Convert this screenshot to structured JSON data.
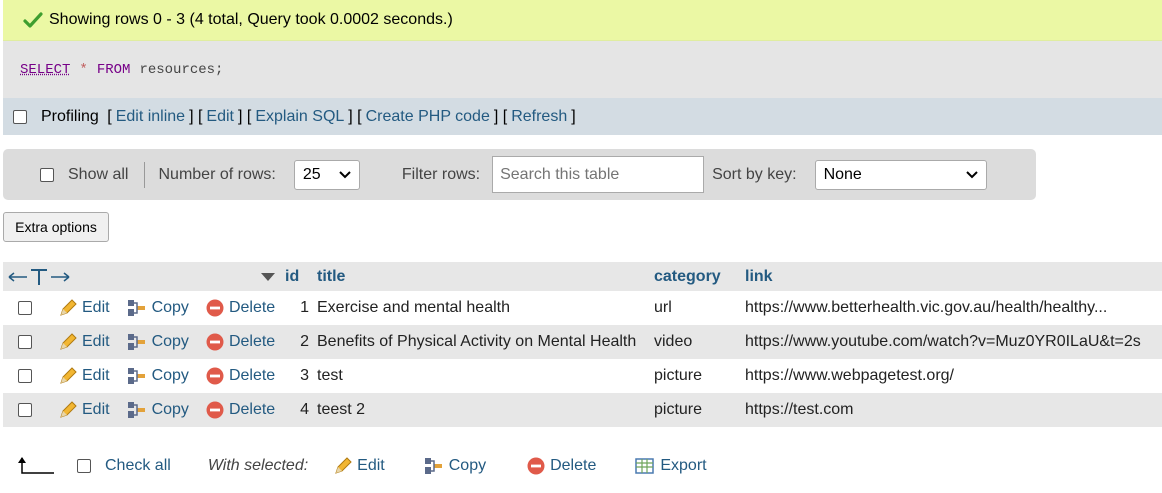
{
  "banner": {
    "message": "Showing rows 0 - 3 (4 total, Query took 0.0002 seconds.)"
  },
  "sql": {
    "select": "SELECT",
    "star": "*",
    "from": "FROM",
    "rest": "resources;"
  },
  "profiling": {
    "label": "Profiling",
    "links": [
      "Edit inline",
      "Edit",
      "Explain SQL",
      "Create PHP code",
      "Refresh"
    ]
  },
  "nav": {
    "show_all": "Show all",
    "rows_label": "Number of rows:",
    "rows_value": "25",
    "filter_label": "Filter rows:",
    "search_placeholder": "Search this table",
    "sort_label": "Sort by key:",
    "sort_value": "None"
  },
  "extra_options": "Extra options",
  "table": {
    "columns": [
      "id",
      "title",
      "category",
      "link"
    ],
    "action_labels": {
      "edit": "Edit",
      "copy": "Copy",
      "delete": "Delete"
    },
    "rows": [
      {
        "id": "1",
        "title": "Exercise and mental health",
        "category": "url",
        "link": "https://www.betterhealth.vic.gov.au/health/healthy..."
      },
      {
        "id": "2",
        "title": "Benefits of Physical Activity on Mental Health",
        "category": "video",
        "link": "https://www.youtube.com/watch?v=Muz0YR0ILaU&t=2s"
      },
      {
        "id": "3",
        "title": "test",
        "category": "picture",
        "link": "https://www.webpagetest.org/"
      },
      {
        "id": "4",
        "title": "teest 2",
        "category": "picture",
        "link": "https://test.com"
      }
    ]
  },
  "bottom": {
    "check_all": "Check all",
    "with_selected": "With selected:",
    "edit": "Edit",
    "copy": "Copy",
    "delete": "Delete",
    "export": "Export"
  },
  "colors": {
    "banner_bg": "#ebf8a4",
    "link": "#235a81",
    "header_bg": "#e7e7e7",
    "profbar_bg": "#d3dce3"
  }
}
